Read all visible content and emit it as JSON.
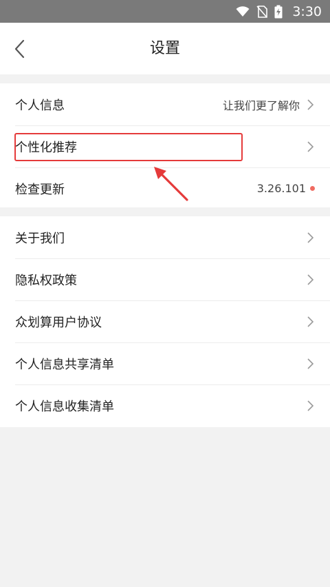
{
  "status_bar": {
    "time": "3:30",
    "icons": [
      "wifi-icon",
      "no-sim-icon",
      "battery-charging-icon"
    ]
  },
  "header": {
    "title": "设置",
    "back_icon": "chevron-left-icon"
  },
  "group1": {
    "items": [
      {
        "label": "个人信息",
        "value": "让我们更了解你"
      },
      {
        "label": "个性化推荐",
        "value": ""
      },
      {
        "label": "检查更新",
        "value": "3.26.101",
        "badge_color": "#f06b61"
      }
    ]
  },
  "group2": {
    "items": [
      {
        "label": "关于我们"
      },
      {
        "label": "隐私权政策"
      },
      {
        "label": "众划算用户协议"
      },
      {
        "label": "个人信息共享清单"
      },
      {
        "label": "个人信息收集清单"
      }
    ]
  },
  "annotation": {
    "highlight_color": "#e53a3a",
    "target": "个性化推荐"
  }
}
